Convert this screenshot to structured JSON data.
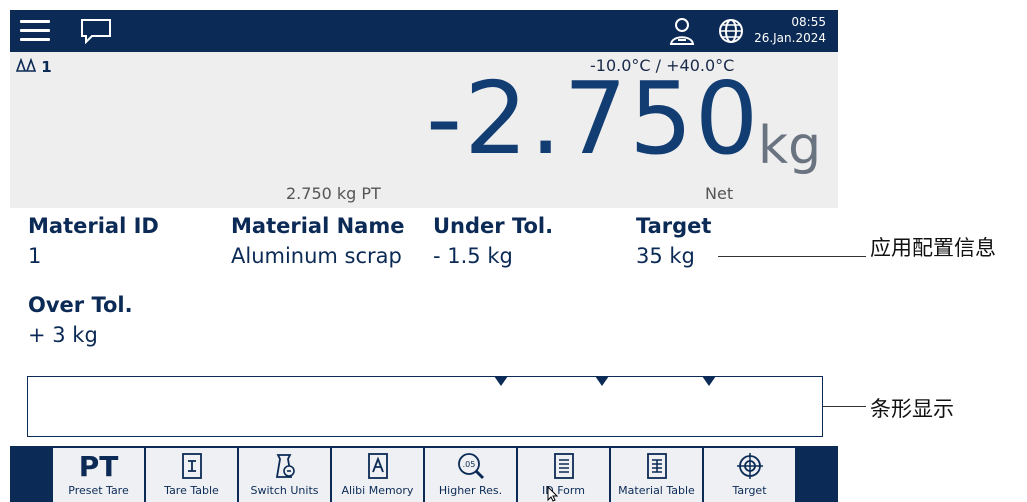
{
  "topbar": {
    "icons": [
      "menu-icon",
      "message-icon",
      "user-icon",
      "globe-icon"
    ],
    "time": "08:55",
    "date": "26.Jan.2024"
  },
  "weigh": {
    "scale_no": "1",
    "range": "-10.0°C / +40.0°C",
    "weight": "-2.750",
    "unit": "kg",
    "preset_tare": "2.750 kg PT",
    "mode": "Net"
  },
  "fields": [
    {
      "label": "Material ID",
      "value": "1"
    },
    {
      "label": "Material Name",
      "value": "Aluminum scrap"
    },
    {
      "label": "Under Tol.",
      "value": "- 1.5 kg"
    },
    {
      "label": "Target",
      "value": "35 kg"
    },
    {
      "label": "Over Tol.",
      "value": "+ 3 kg"
    }
  ],
  "callouts": {
    "app_info": "应用配置信息",
    "bar_display": "条形显示"
  },
  "softkeys": [
    {
      "label": "Preset Tare",
      "icon": "preset-tare-icon",
      "glyph": "PT"
    },
    {
      "label": "Tare Table",
      "icon": "tare-table-icon"
    },
    {
      "label": "Switch Units",
      "icon": "switch-units-icon"
    },
    {
      "label": "Alibi Memory",
      "icon": "alibi-memory-icon"
    },
    {
      "label": "Higher Res.",
      "icon": "higher-resolution-icon"
    },
    {
      "label": "ID Form",
      "icon": "id-form-icon"
    },
    {
      "label": "Material Table",
      "icon": "material-table-icon"
    },
    {
      "label": "Target",
      "icon": "target-icon"
    }
  ],
  "colors": {
    "navy": "#0b2a55",
    "weight": "#123d73",
    "panel": "#eeeeee"
  }
}
